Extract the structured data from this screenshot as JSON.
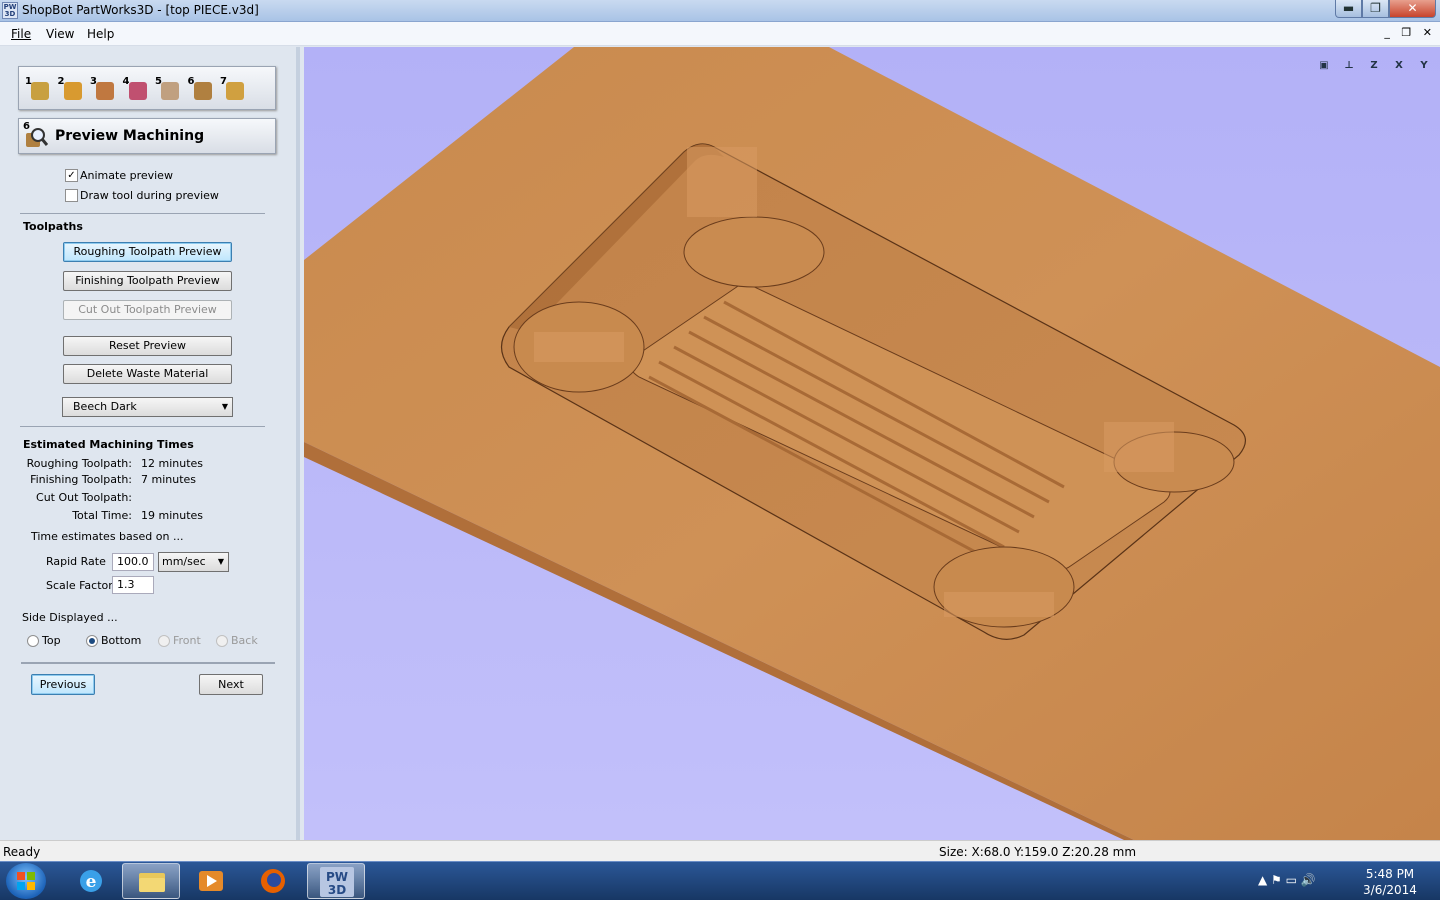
{
  "window": {
    "app_icon_text": "PW 3D",
    "title": "ShopBot PartWorks3D - [top PIECE.v3d]",
    "minimize": "▬",
    "maximize": "❐",
    "close": "✕"
  },
  "menu": {
    "file": "File",
    "view": "View",
    "help": "Help",
    "mdi_controls": "_ ❐ ✕"
  },
  "panel": {
    "steps": [
      {
        "num": "1",
        "icon": "model-box-icon",
        "color": "#c8a040"
      },
      {
        "num": "2",
        "icon": "material-arrow-icon",
        "color": "#d89a30"
      },
      {
        "num": "3",
        "icon": "roughing-arrows-icon",
        "color": "#c07840"
      },
      {
        "num": "4",
        "icon": "finishing-arrows-icon",
        "color": "#c05070"
      },
      {
        "num": "5",
        "icon": "cutout-arrows-icon",
        "color": "#c0a080"
      },
      {
        "num": "6",
        "icon": "preview-magnifier-icon",
        "color": "#b08040"
      },
      {
        "num": "7",
        "icon": "save-toolpath-icon",
        "color": "#d0a040"
      }
    ],
    "header_num": "6",
    "header_title": "Preview Machining",
    "animate_preview": {
      "label": "Animate preview",
      "checked": true
    },
    "draw_tool": {
      "label": "Draw tool during preview",
      "checked": false
    },
    "toolpaths_heading": "Toolpaths",
    "btn_roughing": "Roughing Toolpath Preview",
    "btn_finishing": "Finishing Toolpath Preview",
    "btn_cutout": "Cut Out Toolpath Preview",
    "btn_reset": "Reset Preview",
    "btn_delete_waste": "Delete Waste Material",
    "material_select": "Beech Dark",
    "times_heading": "Estimated Machining Times",
    "times": [
      {
        "label": "Roughing Toolpath:",
        "value": "12 minutes"
      },
      {
        "label": "Finishing Toolpath:",
        "value": "7 minutes"
      },
      {
        "label": "Cut Out Toolpath:",
        "value": ""
      },
      {
        "label": "Total Time:",
        "value": "19 minutes"
      }
    ],
    "based_on": "Time estimates based on ...",
    "rapid_rate_label": "Rapid Rate",
    "rapid_rate_value": "100.0",
    "rapid_rate_unit": "mm/sec",
    "scale_factor_label": "Scale Factor",
    "scale_factor_value": "1.3",
    "side_displayed": "Side Displayed ...",
    "sides": [
      {
        "label": "Top",
        "selected": false,
        "enabled": true
      },
      {
        "label": "Bottom",
        "selected": true,
        "enabled": true
      },
      {
        "label": "Front",
        "selected": false,
        "enabled": false
      },
      {
        "label": "Back",
        "selected": false,
        "enabled": false
      }
    ],
    "btn_previous": "Previous",
    "btn_next": "Next"
  },
  "viewport": {
    "background": "#b8b6f8",
    "wood_top": "#c98a4e",
    "wood_side": "#b8743a",
    "view_icons": [
      "fit-view-icon",
      "iso-view-icon",
      "top-z-view-icon",
      "front-x-view-icon",
      "side-y-view-icon"
    ],
    "view_icon_labels": [
      "▣",
      "⊥",
      "Z",
      "X",
      "Y"
    ]
  },
  "status": {
    "ready": "Ready",
    "size": "Size: X:68.0 Y:159.0 Z:20.28 mm"
  },
  "taskbar": {
    "tray": "▲  ⚑  ▭  🔊",
    "time": "5:48 PM",
    "date": "3/6/2014"
  }
}
